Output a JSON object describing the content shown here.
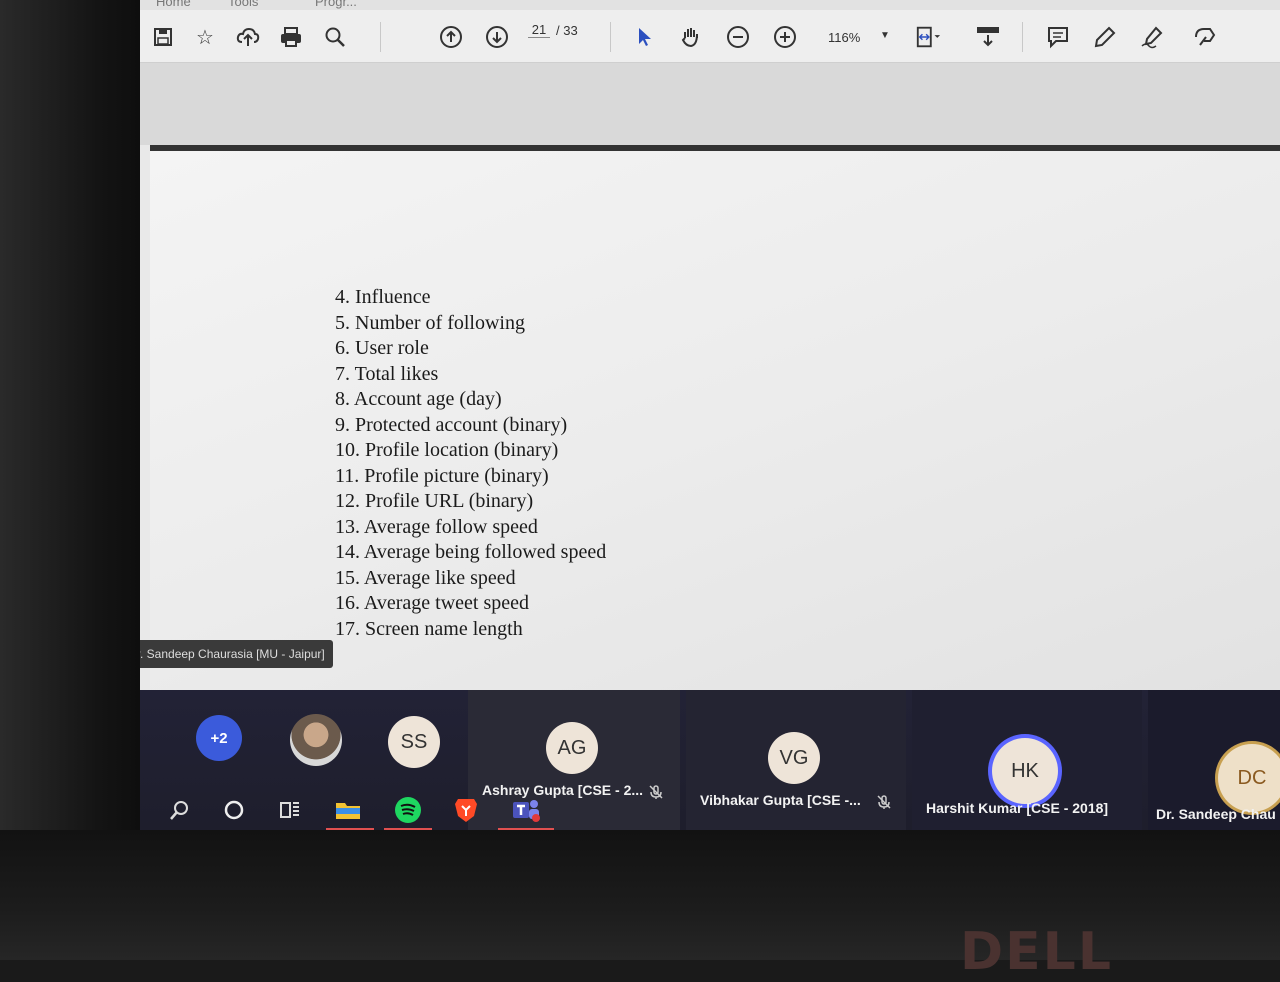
{
  "menu": {
    "items": [
      "Home",
      "Tools",
      "Progr..."
    ]
  },
  "toolbar": {
    "icons": [
      "save-icon",
      "star-icon",
      "upload-icon",
      "print-icon",
      "search-icon",
      "page-up-icon",
      "page-down-icon",
      "cursor-icon",
      "hand-icon",
      "zoom-out-icon",
      "zoom-in-icon",
      "fit-page-icon",
      "scroll-icon",
      "comment-icon",
      "highlight-icon",
      "sign-icon",
      "share-icon"
    ],
    "current_page": "21",
    "total_pages": "/ 33",
    "zoom": "116%"
  },
  "document": {
    "items": [
      "4. Influence",
      "5. Number of following",
      "6. User role",
      "7. Total likes",
      "8. Account age (day)",
      "9. Protected account (binary)",
      "10. Profile location (binary)",
      "11. Profile picture (binary)",
      "12. Profile URL (binary)",
      "13. Average follow speed",
      "14. Average being followed speed",
      "15. Average like speed",
      "16. Average tweet speed",
      "17. Screen name length"
    ]
  },
  "presenter": {
    "label": "Dr. Sandeep Chaurasia [MU - Jaipur]"
  },
  "meeting": {
    "overflow_count": "+2",
    "participants": [
      {
        "initials": "SS",
        "name": ""
      },
      {
        "initials": "AG",
        "name": "Ashray Gupta [CSE - 2..."
      },
      {
        "initials": "VG",
        "name": "Vibhakar Gupta [CSE -..."
      },
      {
        "initials": "HK",
        "name": "Harshit Kumar [CSE - 2018]"
      },
      {
        "initials": "DC",
        "name": "Dr. Sandeep Chau"
      }
    ]
  },
  "taskbar": {
    "apps": [
      "windows-icon",
      "search-icon",
      "cortana-icon",
      "task-view-icon",
      "file-explorer-icon",
      "spotify-icon",
      "brave-icon",
      "teams-icon"
    ]
  },
  "brand": {
    "logo": "DELL"
  }
}
